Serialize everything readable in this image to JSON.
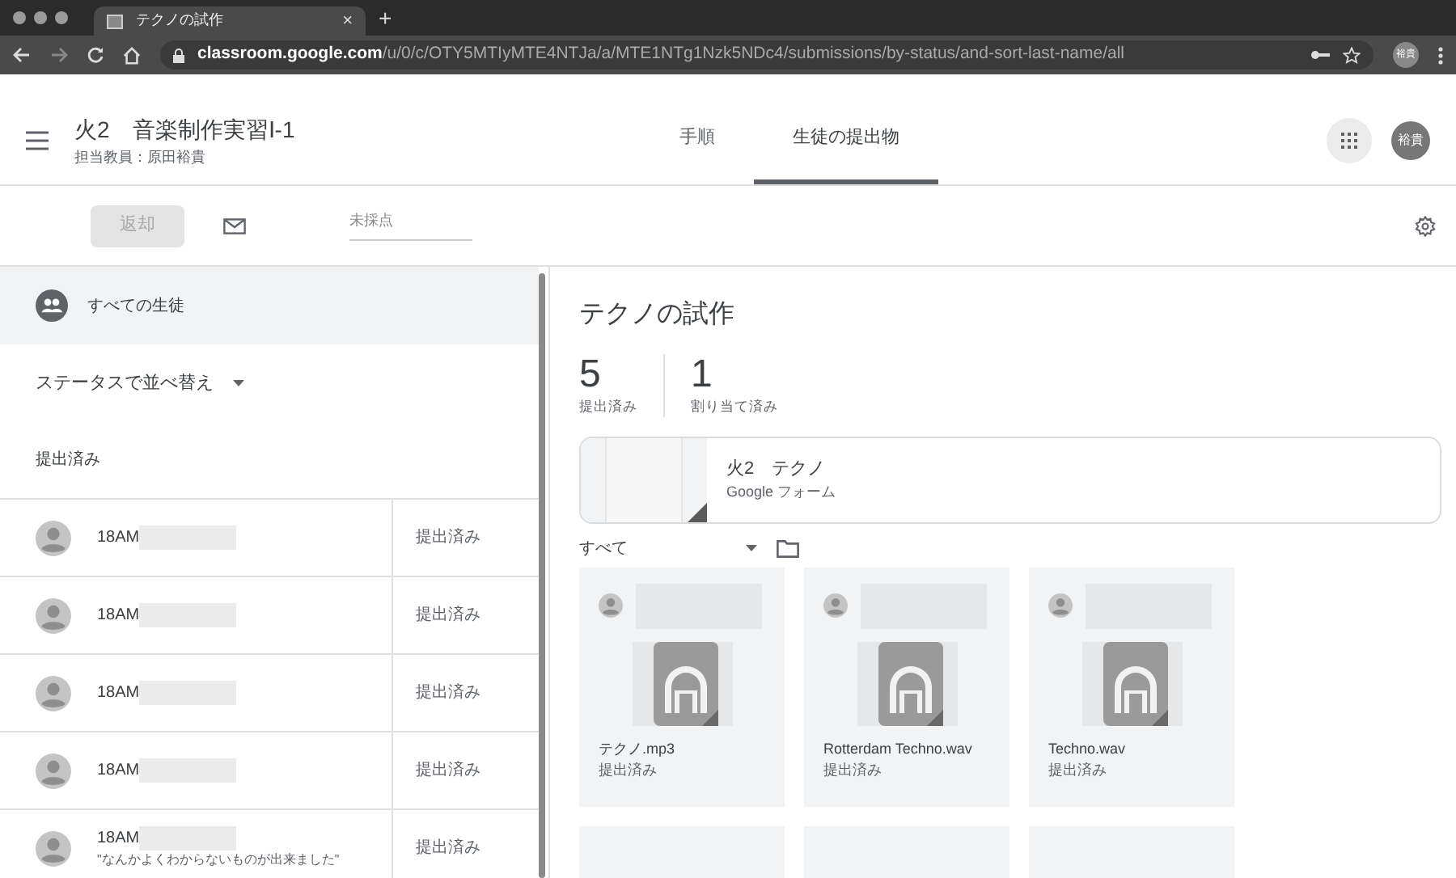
{
  "browser": {
    "tab_title": "テクノの試作",
    "tab_close": "×",
    "new_tab": "+",
    "url_host": "classroom.google.com",
    "url_path": "/u/0/c/OTY5MTIyMTE4NTJa/a/MTE1NTg1Nzk5NDc4/submissions/by-status/and-sort-last-name/all",
    "avatar": "裕貴"
  },
  "header": {
    "class_name": "火2　音楽制作実習Ⅰ-1",
    "teacher": "担当教員：原田裕貴",
    "avatar": "裕貴"
  },
  "tabs": [
    {
      "label": "手順",
      "selected": false
    },
    {
      "label": "生徒の提出物",
      "selected": true
    }
  ],
  "toolbar": {
    "return_button": "返却",
    "return_disabled": true,
    "grade_placeholder": "未採点"
  },
  "sidebar": {
    "all_students": "すべての生徒",
    "sort_label": "ステータスで並べ替え",
    "section": "提出済み",
    "students": [
      {
        "name": "18AM",
        "status": "提出済み"
      },
      {
        "name": "18AM",
        "status": "提出済み"
      },
      {
        "name": "18AM",
        "status": "提出済み"
      },
      {
        "name": "18AM",
        "status": "提出済み"
      },
      {
        "name": "18AM",
        "comment": "\"なんかよくわからないものが出来ました\"",
        "status": "提出済み"
      }
    ]
  },
  "assignment": {
    "title": "テクノの試作",
    "stats": [
      {
        "count": "5",
        "label": "提出済み"
      },
      {
        "count": "1",
        "label": "割り当て済み"
      }
    ],
    "attachment": {
      "title": "火2　テクノ",
      "type": "Google フォーム"
    },
    "filter": "すべて",
    "submissions": [
      {
        "file": "テクノ.mp3",
        "status": "提出済み"
      },
      {
        "file": "Rotterdam Techno.wav",
        "status": "提出済み"
      },
      {
        "file": "Techno.wav",
        "status": "提出済み"
      }
    ]
  }
}
